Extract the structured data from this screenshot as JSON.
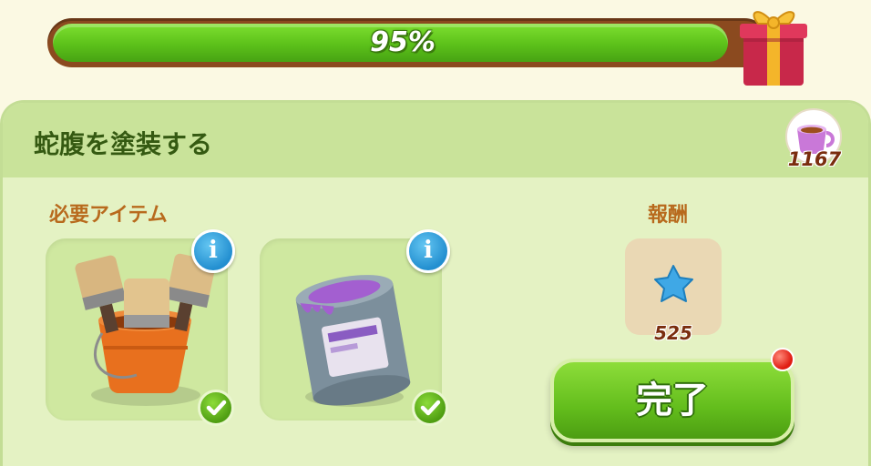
{
  "progress": {
    "percent_label": "95%",
    "value": 0.95
  },
  "task": {
    "title": "蛇腹を塗装する",
    "cup_count": "1167"
  },
  "required": {
    "label": "必要アイテム",
    "items": [
      {
        "name": "paint brushes in bucket",
        "info": "i",
        "collected": true
      },
      {
        "name": "purple paint can",
        "info": "i",
        "collected": true
      }
    ]
  },
  "reward": {
    "label": "報酬",
    "icon": "blue-star-icon",
    "value": "525"
  },
  "actions": {
    "complete_label": "完了"
  },
  "colors": {
    "accent_green": "#63bd1c",
    "info_blue": "#238fd0",
    "alert_red": "#e01d12"
  }
}
